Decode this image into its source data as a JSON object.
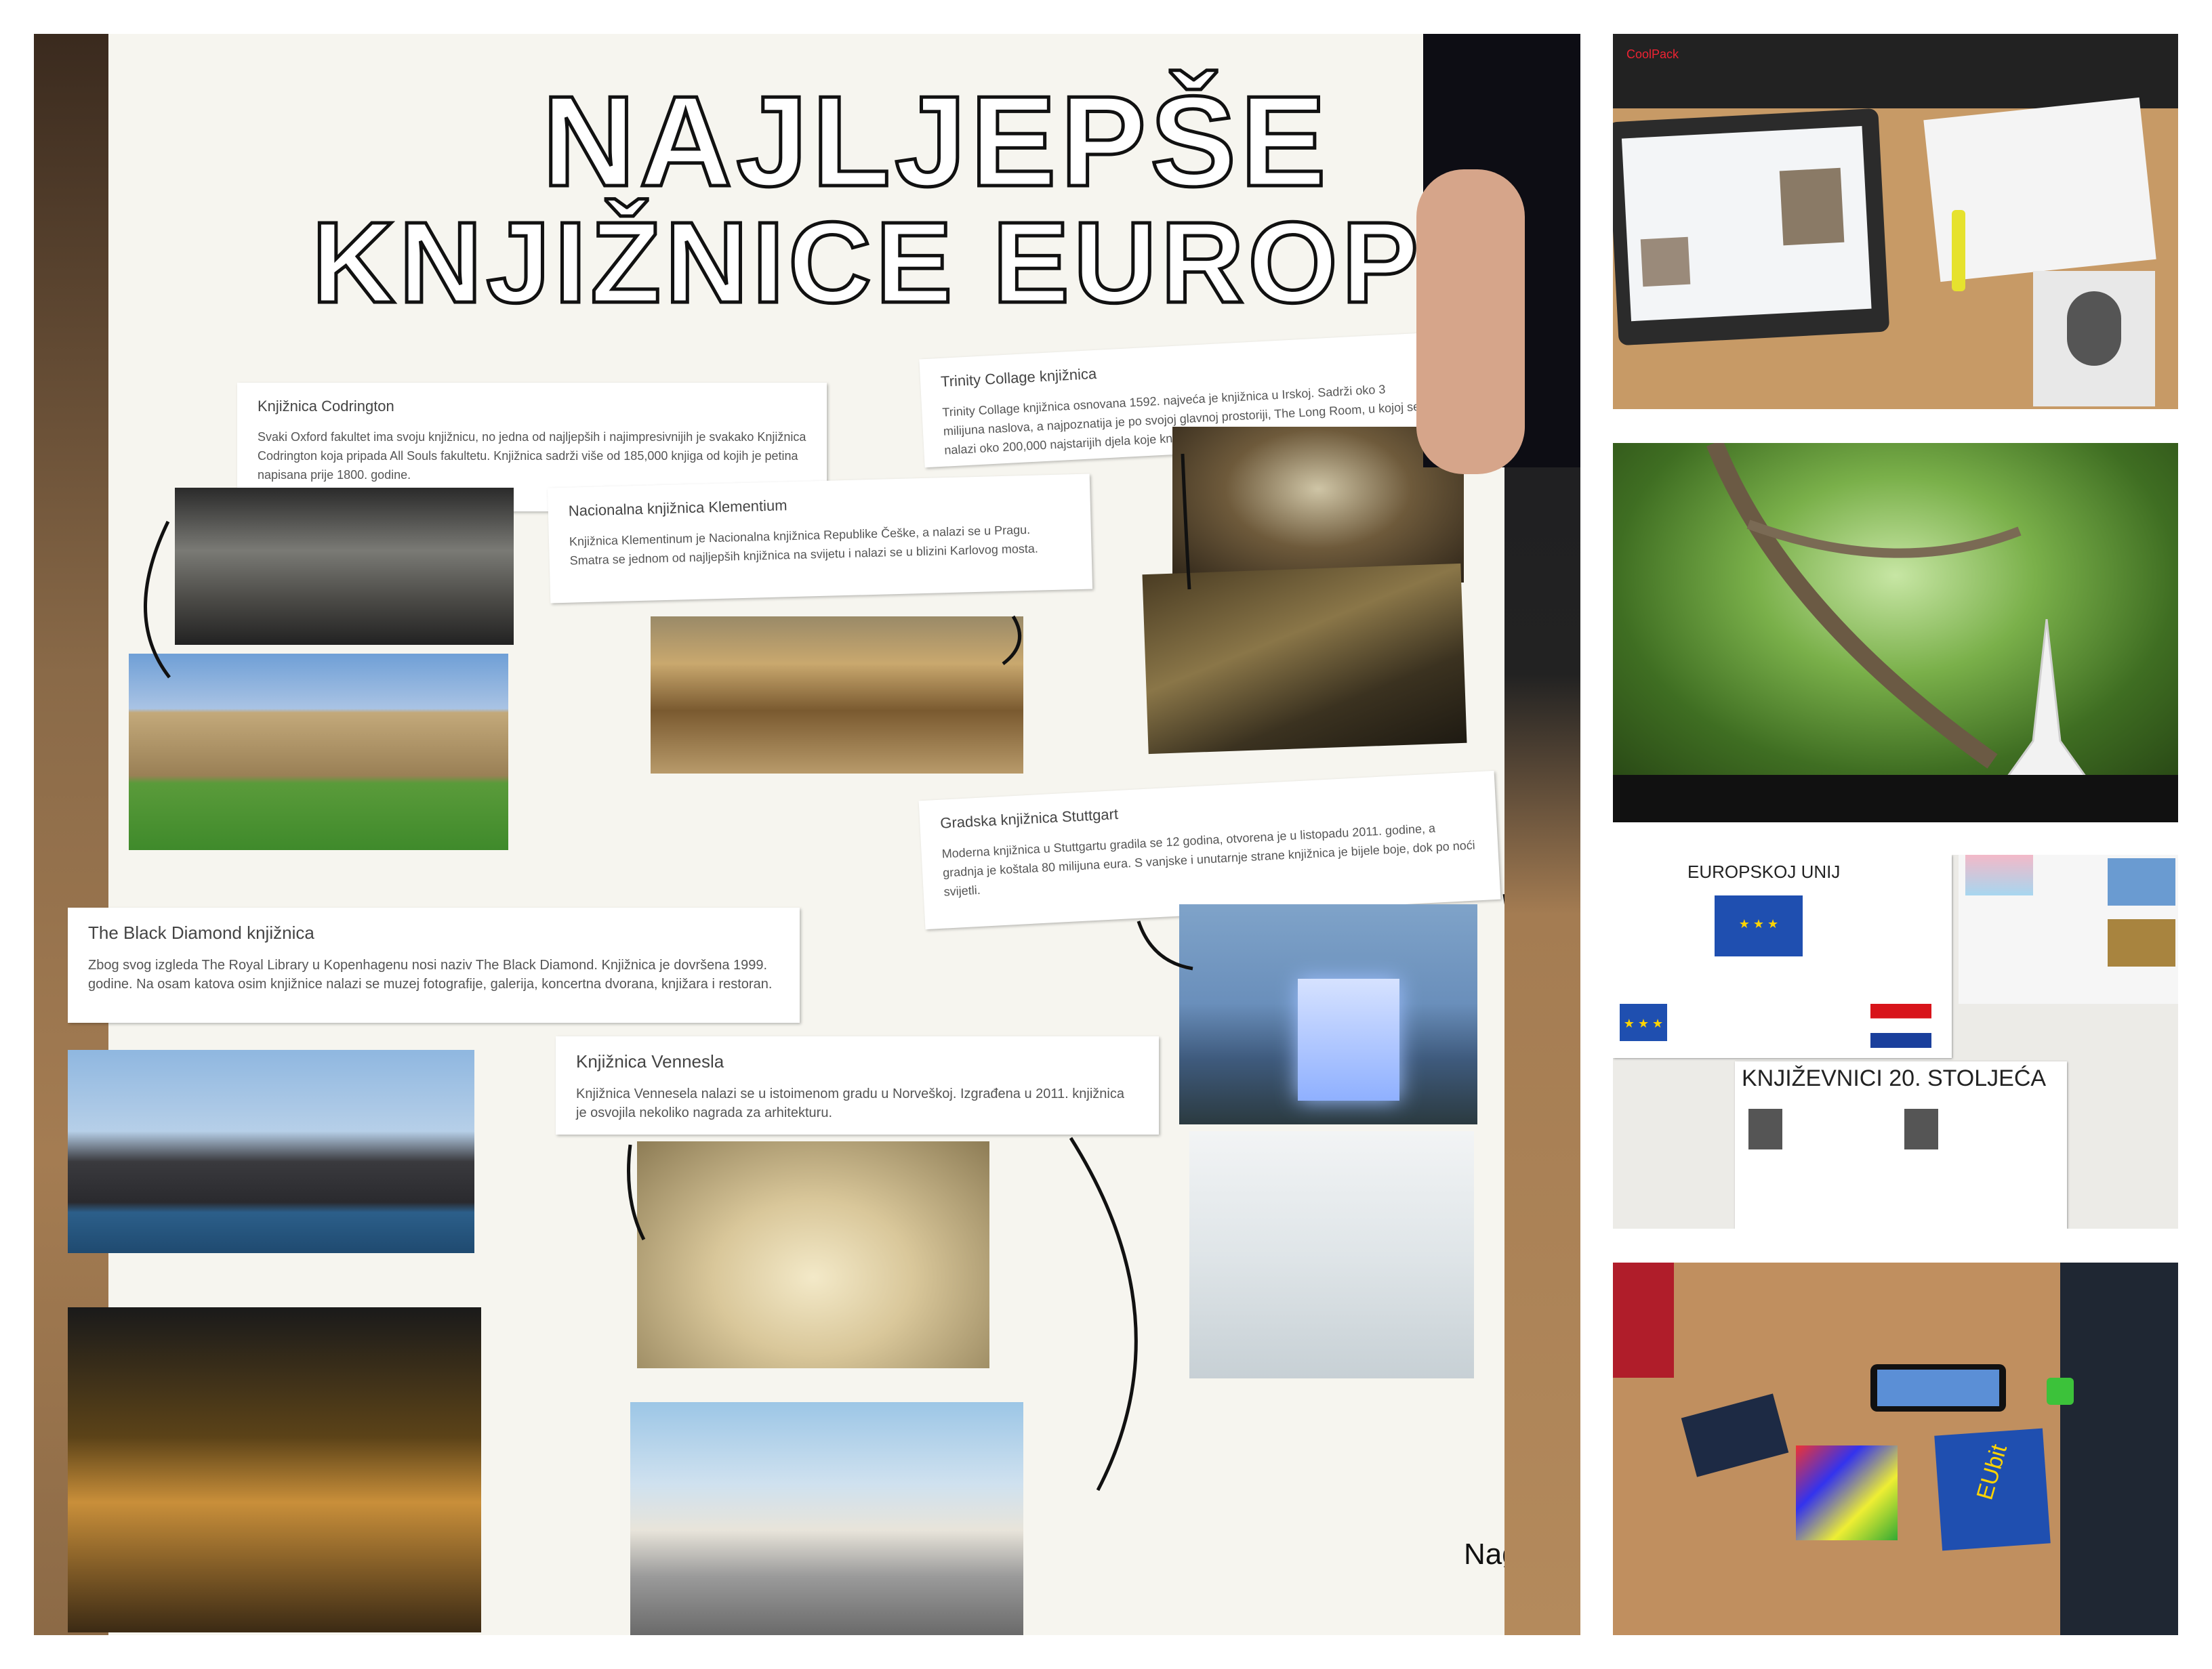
{
  "poster": {
    "title_line1": "NAJLJEPŠE",
    "title_line2": "KNJIŽNICE EUROPE",
    "boxes": {
      "codrington": {
        "heading": "Knjižnica Codrington",
        "body": "Svaki Oxford fakultet ima svoju knjižnicu, no jedna od najljepših i najimpresivnijih je svakako Knjižnica Codrington koja pripada All Souls fakultetu. Knjižnica sadrži više od 185,000 knjiga od kojih je petina napisana prije 1800. godine."
      },
      "trinity": {
        "heading": "Trinity Collage knjižnica",
        "body": "Trinity Collage knjižnica osnovana 1592. najveća je knjižnica u Irskoj. Sadrži oko 3 milijuna naslova, a najpoznatija je po svojoj glavnoj prostoriji, The Long Room, u kojoj se nalazi oko 200,000 najstarijih djela koje knjižnica posjeduje."
      },
      "klementium": {
        "heading": "Nacionalna knjižnica Klementium",
        "body": "Knjižnica Klementinum je Nacionalna knjižnica Republike Češke, a nalazi se u Pragu. Smatra se jednom od najljepših knjižnica na svijetu i nalazi se u blizini Karlovog mosta."
      },
      "stuttgart": {
        "heading": "Gradska knjižnica Stuttgart",
        "body": "Moderna knjižnica u Stuttgartu gradila se 12 godina, otvorena je u listopadu 2011. godine, a gradnja je koštala 80 milijuna eura. S vanjske i unutarnje strane knjižnica je bijele boje, dok po noći svijetli."
      },
      "black_diamond": {
        "heading": "The Black Diamond knjižnica",
        "body": "Zbog svog izgleda The Royal Library u Kopenhagenu nosi naziv The Black Diamond. Knjižnica je dovršena 1999. godine. Na osam katova osim knjižnice nalazi se muzej fotografije, galerija, koncertna dvorana, knjižara i restoran."
      },
      "vennesla": {
        "heading": "Knjižnica Vennesla",
        "body": "Knjižnica Vennesela nalazi se u istoimenom gradu u Norveškoj. Izgrađena u 2011. knjižnica je osvojila nekoliko nagrada za arhitekturu."
      }
    },
    "corner_note": "Nagra je"
  },
  "side_panels": {
    "panel1": {
      "case_brand": "CoolPack"
    },
    "panel3": {
      "banner1": "EUROPSKOJ UNIJ",
      "banner2": "KNJIŽEVNICI 20. STOLJEĆA"
    },
    "panel4": {
      "card_text": "EUbit"
    }
  },
  "colors": {
    "poster_bg": "#f6f5ef",
    "eu_blue": "#1f4fb0",
    "eu_yellow": "#ffd400"
  }
}
